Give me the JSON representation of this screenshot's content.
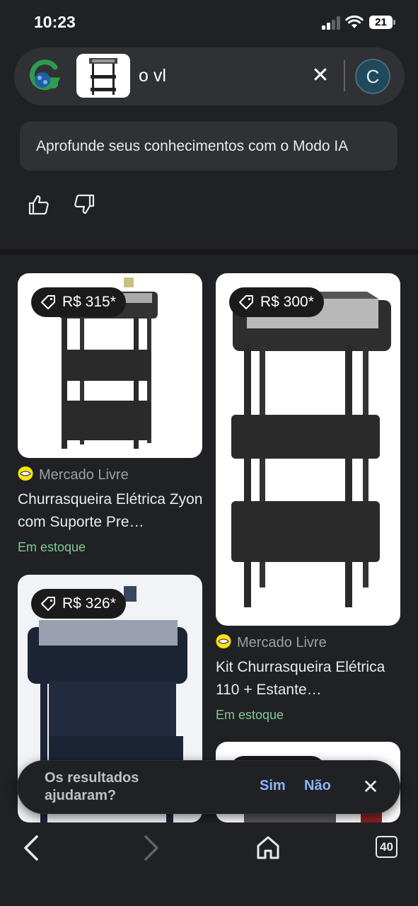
{
  "status_bar": {
    "time": "10:23",
    "battery": "21"
  },
  "search": {
    "query": "o vl"
  },
  "account": {
    "initial": "C"
  },
  "ai_mode": {
    "label": "Aprofunde seus conhecimentos com o Modo IA"
  },
  "results": [
    {
      "price": "R$ 315*",
      "seller": "Mercado Livre",
      "title": "Churrasqueira Elétrica Zyon com Suporte Pre…",
      "stock": "Em estoque"
    },
    {
      "price": "R$ 300*",
      "seller": "Mercado Livre",
      "title": "Kit Churrasqueira Elétrica 110 + Estante…",
      "stock": "Em estoque"
    },
    {
      "price": "R$ 326*"
    }
  ],
  "feedback": {
    "question": "Os resultados ajudaram?",
    "yes": "Sim",
    "no": "Não"
  },
  "nav": {
    "tab_count": "40"
  },
  "colors": {
    "background": "#202124",
    "surface": "#303134",
    "accent": "#8ab4f8",
    "stock_green": "#81c995"
  },
  "icons": [
    "google-lens-icon",
    "close-icon",
    "thumbs-up-icon",
    "thumbs-down-icon",
    "price-tag-icon",
    "mercado-livre-icon",
    "back-icon",
    "forward-icon",
    "home-icon",
    "tabs-icon"
  ]
}
